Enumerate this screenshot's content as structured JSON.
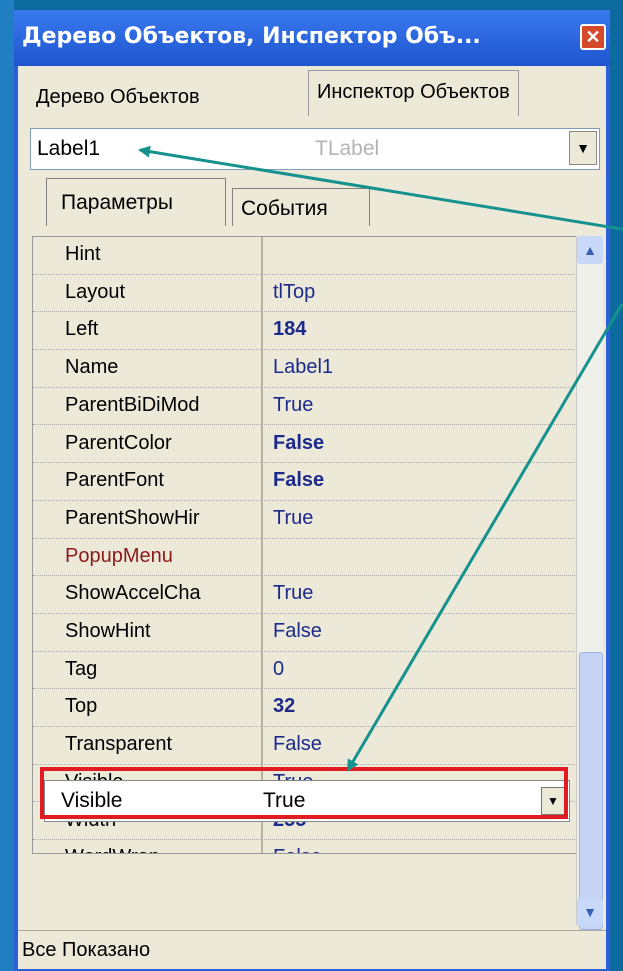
{
  "window": {
    "title": "Дерево Объектов, Инспектор Объ...",
    "close_glyph": "✕"
  },
  "tabs": {
    "tree_label": "Дерево Объектов",
    "inspector_label": "Инспектор Объектов"
  },
  "object_combo": {
    "name": "Label1",
    "class": "TLabel",
    "button_glyph": "▼"
  },
  "subtabs": {
    "params_label": "Параметры",
    "events_label": "События"
  },
  "properties": [
    {
      "name": "Hint",
      "value": "",
      "bold": false
    },
    {
      "name": "Layout",
      "value": "tlTop",
      "bold": false
    },
    {
      "name": "Left",
      "value": "184",
      "bold": true
    },
    {
      "name": "Name",
      "value": "Label1",
      "bold": false
    },
    {
      "name": "ParentBiDiMod",
      "value": "True",
      "bold": false
    },
    {
      "name": "ParentColor",
      "value": "False",
      "bold": true
    },
    {
      "name": "ParentFont",
      "value": "False",
      "bold": true
    },
    {
      "name": "ParentShowHir",
      "value": "True",
      "bold": false
    },
    {
      "name": "PopupMenu",
      "value": "",
      "bold": false,
      "color": "#8b1a1a"
    },
    {
      "name": "ShowAccelCha",
      "value": "True",
      "bold": false
    },
    {
      "name": "ShowHint",
      "value": "False",
      "bold": false
    },
    {
      "name": "Tag",
      "value": "0",
      "bold": false
    },
    {
      "name": "Top",
      "value": "32",
      "bold": true
    },
    {
      "name": "Transparent",
      "value": "False",
      "bold": false
    },
    {
      "name": "Visible",
      "value": "True",
      "bold": false,
      "selected": true
    },
    {
      "name": "Width",
      "value": "255",
      "bold": true
    },
    {
      "name": "WordWrap",
      "value": "False",
      "bold": false
    }
  ],
  "editor": {
    "name": "Visible",
    "value": "True",
    "button_glyph": "▼"
  },
  "scrollbar": {
    "up_glyph": "▲",
    "down_glyph": "▼"
  },
  "status": {
    "text": "Все Показано"
  },
  "colors": {
    "value_text": "#1c2a8a",
    "highlight": "#e11b22",
    "arrow": "#15928e",
    "title_bg": "#2c5fd8"
  }
}
